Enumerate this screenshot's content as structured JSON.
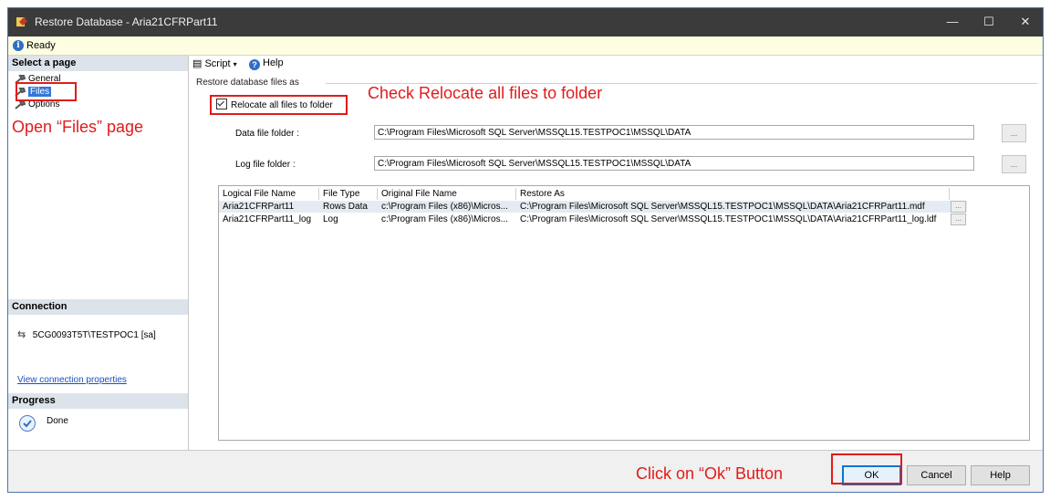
{
  "window": {
    "title": "Restore Database - Aria21CFRPart11",
    "controls": [
      "—",
      "☐",
      "✕"
    ]
  },
  "status": {
    "text": "Ready"
  },
  "left": {
    "select_page_header": "Select a page",
    "pages": [
      {
        "label": "General"
      },
      {
        "label": "Files"
      },
      {
        "label": "Options"
      }
    ],
    "connection_header": "Connection",
    "connection_server": "5CG0093T5T\\TESTPOC1 [sa]",
    "view_connection_link": "View connection properties",
    "progress_header": "Progress",
    "progress_status": "Done"
  },
  "toolbar": {
    "script_label": "Script",
    "help_label": "Help"
  },
  "files": {
    "group_label": "Restore database files as",
    "relocate_label": "Relocate all files to folder",
    "relocate_checked": true,
    "data_label": "Data file folder :",
    "data_value": "C:\\Program Files\\Microsoft SQL Server\\MSSQL15.TESTPOC1\\MSSQL\\DATA",
    "log_label": "Log file folder :",
    "log_value": "C:\\Program Files\\Microsoft SQL Server\\MSSQL15.TESTPOC1\\MSSQL\\DATA",
    "browse_label": "...",
    "grid": {
      "headers": [
        "Logical File Name",
        "File Type",
        "Original File Name",
        "Restore As"
      ],
      "rows": [
        [
          "Aria21CFRPart11",
          "Rows Data",
          "c:\\Program Files (x86)\\Micros...",
          "C:\\Program Files\\Microsoft SQL Server\\MSSQL15.TESTPOC1\\MSSQL\\DATA\\Aria21CFRPart11.mdf"
        ],
        [
          "Aria21CFRPart11_log",
          "Log",
          "c:\\Program Files (x86)\\Micros...",
          "C:\\Program Files\\Microsoft SQL Server\\MSSQL15.TESTPOC1\\MSSQL\\DATA\\Aria21CFRPart11_log.ldf"
        ]
      ],
      "cell_button": "..."
    }
  },
  "buttons": {
    "ok": "OK",
    "cancel": "Cancel",
    "help": "Help"
  },
  "annotations": {
    "files_page": "Open “Files” page",
    "relocate": "Check Relocate all files to folder",
    "ok": "Click on “Ok” Button",
    "color": "#e11b1b"
  },
  "colors": {
    "titlebar": "#3b3b3b",
    "status_bg": "#fdfde2",
    "section_bg": "#dde3ea",
    "selection": "#3377d9",
    "ok_border": "#0078d7"
  }
}
